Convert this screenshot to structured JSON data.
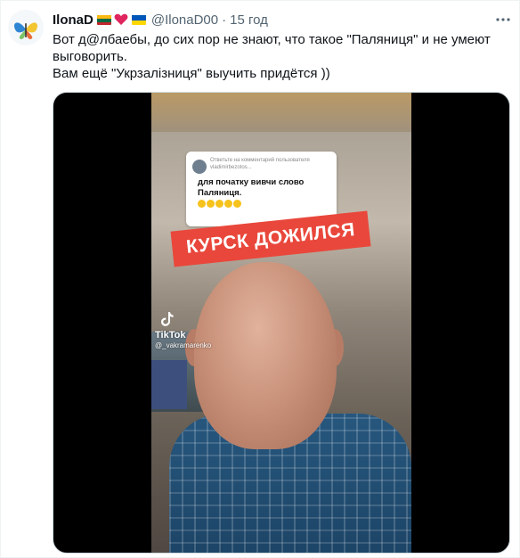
{
  "author": {
    "name": "IlonaD",
    "handle": "@IlonaD00",
    "separator": "·",
    "time": "15 год",
    "avatar_icon": "butterfly-logo-icon",
    "flags": [
      "lithuania-flag-icon",
      "heart-icon",
      "ukraine-flag-icon"
    ]
  },
  "tweet_text": {
    "line1": "Вот д@лбаебы, до сих пор не знают, что такое \"Паляниця\" и не умеют выговорить.",
    "line2": "Вам ещё \"Укрзалізниця\" выучить придётся ))"
  },
  "video": {
    "comment_ref": "Ответьте на комментарий пользователя vladimirbezotos...",
    "comment_text": "для початку вивчи слово Паляниця.",
    "banner_text": "КУРСК ДОЖИЛСЯ",
    "tiktok_label": "TikTok",
    "tiktok_user": "@_vakramarenko"
  },
  "colors": {
    "banner": "#e9473b",
    "name": "#0f1419",
    "secondary": "#536471",
    "ua_blue": "#0057b7",
    "ua_yellow": "#ffd700",
    "heart": "#e0245e"
  }
}
